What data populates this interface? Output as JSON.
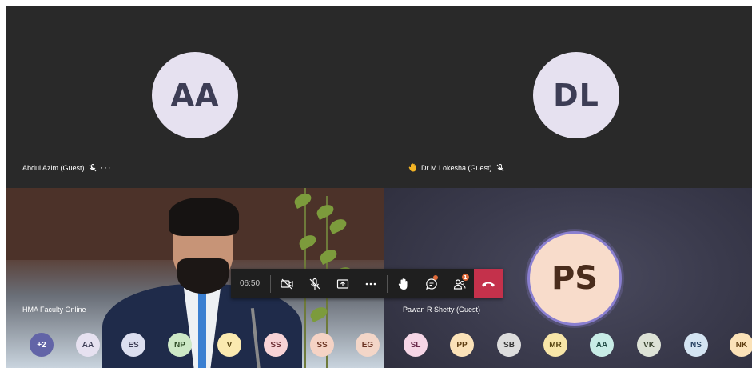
{
  "tiles": {
    "abdul": {
      "initials": "AA",
      "name": "Abdul Azim (Guest)"
    },
    "lokesha": {
      "initials": "DL",
      "name": "Dr M Lokesha (Guest)"
    },
    "video": {
      "name": "HMA Faculty Online"
    },
    "pawan": {
      "initials": "PS",
      "name": "Pawan R Shetty (Guest)"
    }
  },
  "controls": {
    "timer": "06:50",
    "participants_badge": "1"
  },
  "participants": [
    {
      "initials": "+2",
      "bg": "#6264a7",
      "fg": "#ffffff"
    },
    {
      "initials": "AA",
      "bg": "#e6e1f0",
      "fg": "#3d3d55"
    },
    {
      "initials": "ES",
      "bg": "#dcdff0",
      "fg": "#3d3d55"
    },
    {
      "initials": "NP",
      "bg": "#cde8c6",
      "fg": "#2c4a24"
    },
    {
      "initials": "V",
      "bg": "#fbeab0",
      "fg": "#5a4814"
    },
    {
      "initials": "SS",
      "bg": "#f7d3d6",
      "fg": "#6a2b32"
    },
    {
      "initials": "SS",
      "bg": "#f5d3c5",
      "fg": "#6a3322"
    },
    {
      "initials": "EG",
      "bg": "#f3d6c8",
      "fg": "#6a3322"
    },
    {
      "initials": "SL",
      "bg": "#f6d6e6",
      "fg": "#6a2b4c"
    },
    {
      "initials": "PP",
      "bg": "#fbe2b8",
      "fg": "#5e3d10"
    },
    {
      "initials": "SB",
      "bg": "#dcdcdc",
      "fg": "#333333"
    },
    {
      "initials": "MR",
      "bg": "#f8e6a8",
      "fg": "#5a4814"
    },
    {
      "initials": "AA",
      "bg": "#c8ece6",
      "fg": "#1f4a44"
    },
    {
      "initials": "VK",
      "bg": "#dde2d6",
      "fg": "#3a4430"
    },
    {
      "initials": "NS",
      "bg": "#d4e4f2",
      "fg": "#254060"
    },
    {
      "initials": "NK",
      "bg": "#fbe2b8",
      "fg": "#5e3d10"
    }
  ]
}
